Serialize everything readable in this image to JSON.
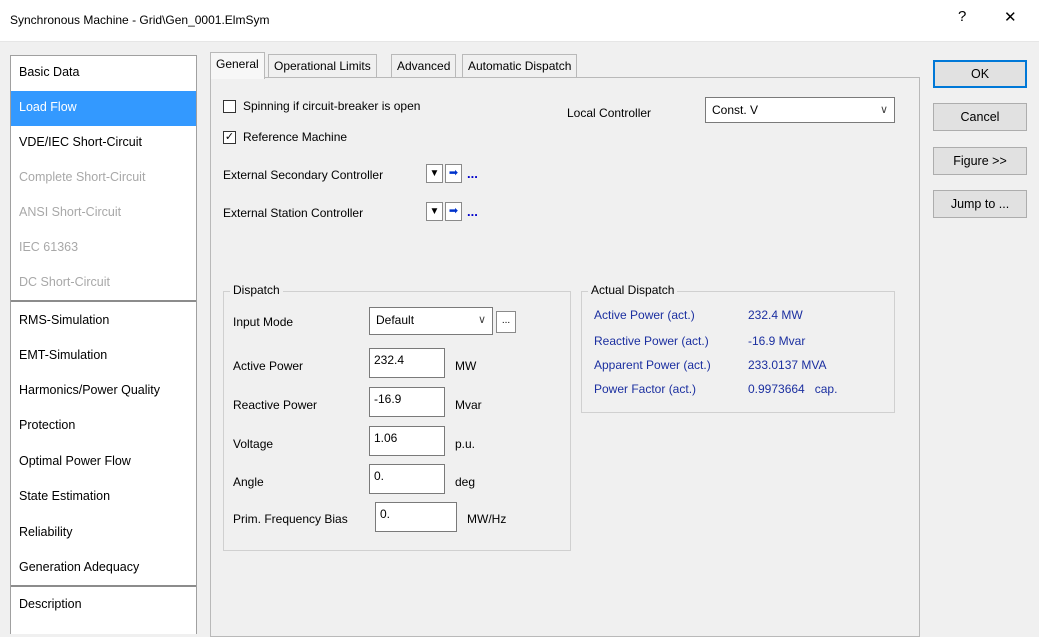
{
  "window": {
    "title": "Synchronous Machine - Grid\\Gen_0001.ElmSym",
    "help_glyph": "?",
    "close_glyph": "✕"
  },
  "sidebar": {
    "items": [
      {
        "label": "Basic Data",
        "state": "normal"
      },
      {
        "label": "Load Flow",
        "state": "selected"
      },
      {
        "label": "VDE/IEC Short-Circuit",
        "state": "normal"
      },
      {
        "label": "Complete Short-Circuit",
        "state": "disabled"
      },
      {
        "label": "ANSI Short-Circuit",
        "state": "disabled"
      },
      {
        "label": "IEC 61363",
        "state": "disabled"
      },
      {
        "label": "DC Short-Circuit",
        "state": "disabled"
      },
      {
        "label": "RMS-Simulation",
        "state": "normal"
      },
      {
        "label": "EMT-Simulation",
        "state": "normal"
      },
      {
        "label": "Harmonics/Power Quality",
        "state": "normal"
      },
      {
        "label": "Protection",
        "state": "normal"
      },
      {
        "label": "Optimal Power Flow",
        "state": "normal"
      },
      {
        "label": "State Estimation",
        "state": "normal"
      },
      {
        "label": "Reliability",
        "state": "normal"
      },
      {
        "label": "Generation Adequacy",
        "state": "normal"
      },
      {
        "label": "Description",
        "state": "normal"
      }
    ]
  },
  "tabs": [
    {
      "label": "General",
      "active": true
    },
    {
      "label": "Operational Limits",
      "active": false
    },
    {
      "label": "Advanced",
      "active": false
    },
    {
      "label": "Automatic Dispatch",
      "active": false
    }
  ],
  "general": {
    "spinning_label": "Spinning if circuit-breaker is open",
    "spinning_checked": false,
    "reference_label": "Reference Machine",
    "reference_checked": true,
    "check_mark": "✓",
    "local_controller_label": "Local Controller",
    "local_controller_value": "Const. V",
    "ext_secondary_label": "External Secondary Controller",
    "ext_station_label": "External Station Controller",
    "ellipsis": "...",
    "down_glyph": "▼",
    "arrow_glyph": "➡"
  },
  "dispatch": {
    "title": "Dispatch",
    "input_mode_label": "Input Mode",
    "input_mode_value": "Default",
    "more_glyph": "...",
    "fields": [
      {
        "label": "Active Power",
        "value": "232.4",
        "unit": "MW"
      },
      {
        "label": "Reactive Power",
        "value": "-16.9",
        "unit": "Mvar"
      },
      {
        "label": "Voltage",
        "value": "1.06",
        "unit": "p.u."
      },
      {
        "label": "Angle",
        "value": "0.",
        "unit": "deg"
      },
      {
        "label": "Prim. Frequency Bias",
        "value": "0.",
        "unit": "MW/Hz"
      }
    ]
  },
  "actual_dispatch": {
    "title": "Actual Dispatch",
    "rows": [
      {
        "label": "Active Power (act.)",
        "value": "232.4 MW"
      },
      {
        "label": "Reactive Power (act.)",
        "value": "-16.9 Mvar"
      },
      {
        "label": "Apparent Power (act.)",
        "value": "233.0137 MVA"
      },
      {
        "label": "Power Factor (act.)",
        "value": "0.9973664   cap."
      }
    ]
  },
  "buttons": {
    "ok": "OK",
    "cancel": "Cancel",
    "figure": "Figure >>",
    "jump": "Jump to ..."
  }
}
